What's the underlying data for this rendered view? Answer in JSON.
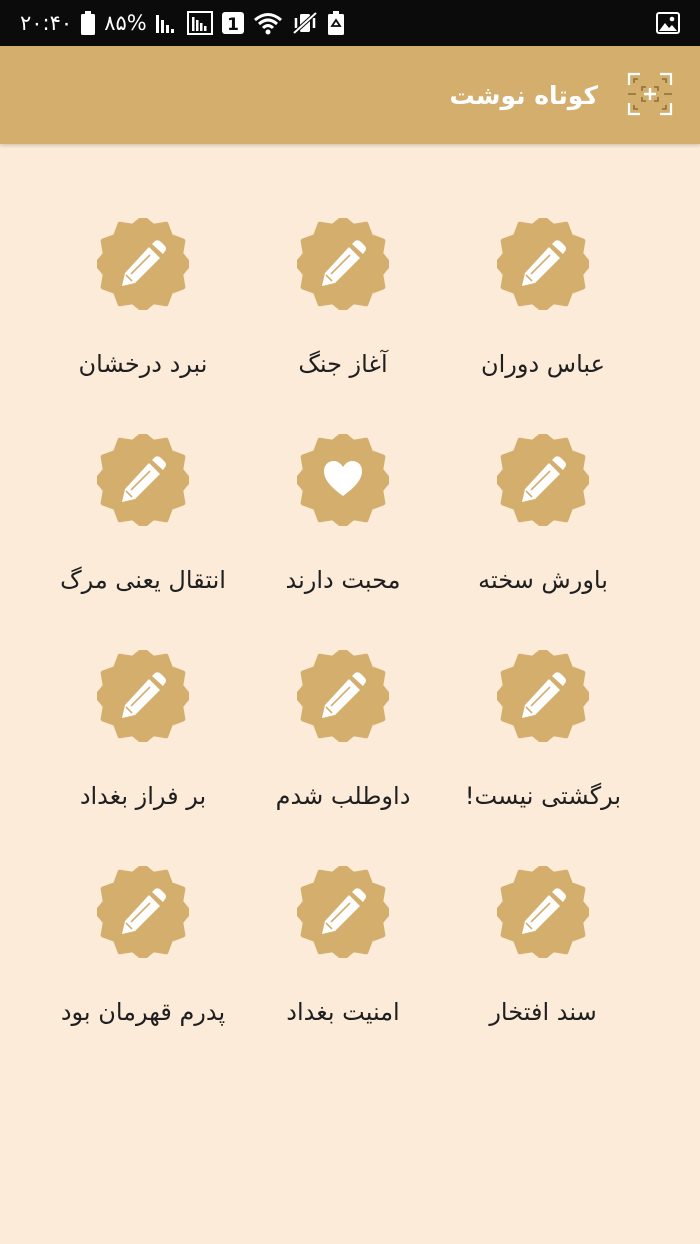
{
  "status_bar": {
    "time": "۲۰:۴۰",
    "battery_percent": "۸۵%",
    "sim_slot": "1",
    "icons": [
      "battery-icon",
      "signal-bars-icon",
      "signal-box-icon",
      "sim-1-icon",
      "wifi-icon",
      "muted-vibrate-icon",
      "recycle-icon",
      "gallery-icon"
    ]
  },
  "app_bar": {
    "title": "کوتاه نوشت",
    "action_icon": "qr-scan-icon",
    "color": "#d4ae6d"
  },
  "colors": {
    "background": "#fcebd9",
    "badge": "#d4ae6d",
    "text": "#1f1f1f"
  },
  "items": [
    {
      "label": "عباس دوران",
      "icon": "pencil-icon"
    },
    {
      "label": "آغاز جنگ",
      "icon": "pencil-icon"
    },
    {
      "label": "نبرد درخشان",
      "icon": "pencil-icon"
    },
    {
      "label": "باورش سخته",
      "icon": "pencil-icon"
    },
    {
      "label": "محبت دارند",
      "icon": "heart-icon"
    },
    {
      "label": "انتقال یعنی مرگ",
      "icon": "pencil-icon"
    },
    {
      "label": "برگشتی نیست!",
      "icon": "pencil-icon"
    },
    {
      "label": "داوطلب شدم",
      "icon": "pencil-icon"
    },
    {
      "label": "بر فراز بغداد",
      "icon": "pencil-icon"
    },
    {
      "label": "سند افتخار",
      "icon": "pencil-icon"
    },
    {
      "label": "امنیت بغداد",
      "icon": "pencil-icon"
    },
    {
      "label": "پدرم قهرمان بود",
      "icon": "pencil-icon"
    }
  ]
}
